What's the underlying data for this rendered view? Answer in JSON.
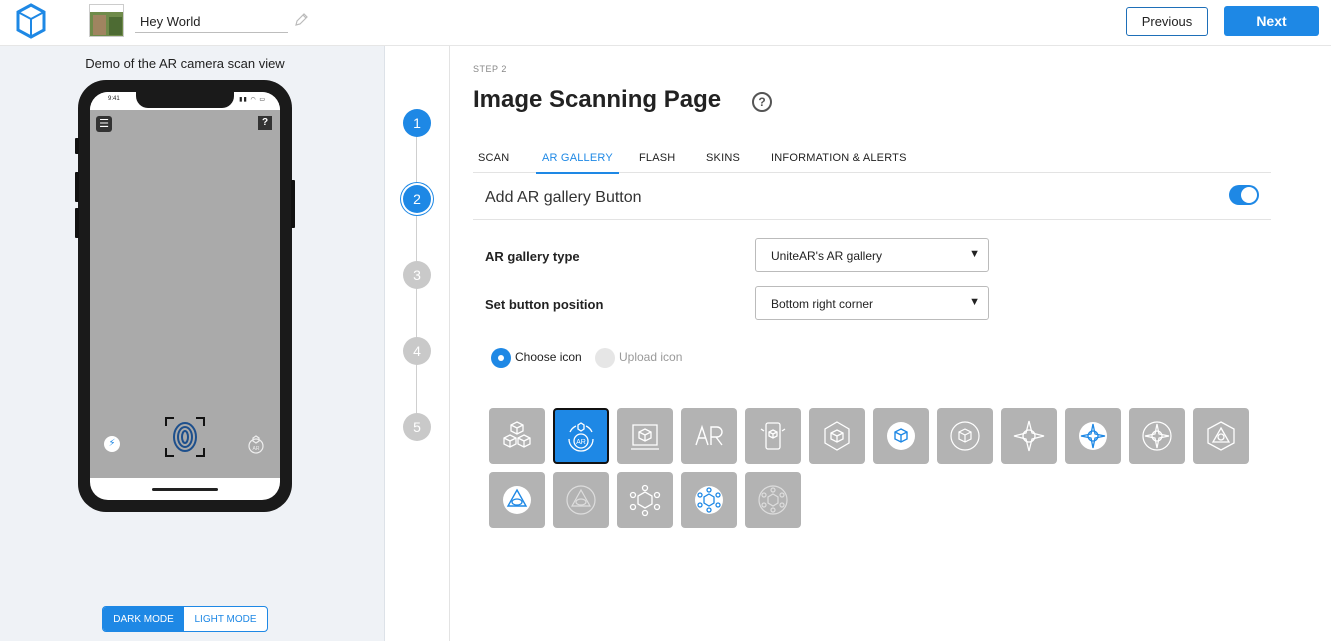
{
  "header": {
    "project_name": "Hey World",
    "previous_label": "Previous",
    "next_label": "Next"
  },
  "preview": {
    "title": "Demo of the AR camera scan view",
    "phone_time": "9:41",
    "help_label": "?",
    "ar_badge": "AR",
    "modes": {
      "dark": "DARK MODE",
      "light": "LIGHT MODE",
      "selected": "dark"
    }
  },
  "stepper": {
    "steps": [
      "1",
      "2",
      "3",
      "4",
      "5"
    ],
    "current": 2
  },
  "main": {
    "step_label": "STEP 2",
    "title": "Image Scanning Page",
    "help_label": "?",
    "tabs": [
      "SCAN",
      "AR GALLERY",
      "FLASH",
      "SKINS",
      "INFORMATION & ALERTS"
    ],
    "selected_tab": "AR GALLERY",
    "section_label": "Add AR gallery Button",
    "section_enabled": true,
    "gallery_type_label": "AR gallery type",
    "gallery_type_value": "UniteAR's AR gallery",
    "position_label": "Set button position",
    "position_value": "Bottom right corner",
    "radio_choose": "Choose icon",
    "radio_upload": "Upload icon",
    "selected_icon": "ar-circle-icon",
    "ar_text": "AR",
    "icons_row1": [
      "cubes-icon",
      "ar-circle-icon",
      "3d-box-screen-icon",
      "ar-text-icon",
      "phone-cube-icon",
      "hexagon-cube-icon",
      "white-cube-icon",
      "outline-cube-icon",
      "compass-cross-icon",
      "white-compass-icon",
      "outline-compass-icon",
      "pyramid-icon"
    ],
    "icons_row2": [
      "white-eye-triangle-icon",
      "outline-eye-triangle-icon",
      "network-cube-icon",
      "white-network-icon",
      "outline-network-icon"
    ],
    "colors": {
      "accent": "#1e88e5",
      "tile_bg": "#b3b3b3"
    }
  }
}
